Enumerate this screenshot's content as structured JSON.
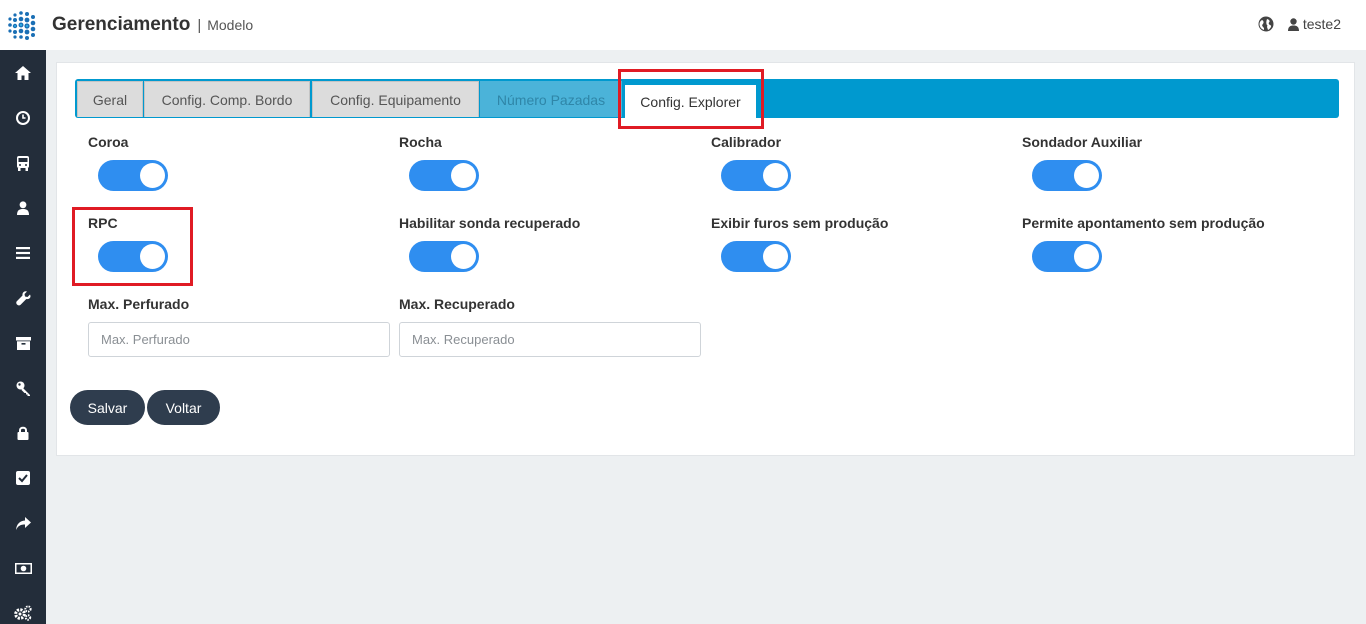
{
  "header": {
    "title": "Gerenciamento",
    "separator": "|",
    "subtitle": "Modelo",
    "globe_icon": "globe-icon",
    "user_icon": "user-icon",
    "username": "teste2"
  },
  "sidebar": {
    "items": [
      {
        "icon": "home-icon"
      },
      {
        "icon": "clock-icon"
      },
      {
        "icon": "bus-icon"
      },
      {
        "icon": "user-icon"
      },
      {
        "icon": "menu-icon"
      },
      {
        "icon": "wrench-icon"
      },
      {
        "icon": "archive-icon"
      },
      {
        "icon": "key-icon"
      },
      {
        "icon": "lock-icon"
      },
      {
        "icon": "checkbox-icon"
      },
      {
        "icon": "share-icon"
      },
      {
        "icon": "money-icon"
      },
      {
        "icon": "gears-icon"
      }
    ]
  },
  "tabs": [
    {
      "label": "Geral"
    },
    {
      "label": "Config. Comp. Bordo"
    },
    {
      "label": "Config. Equipamento"
    },
    {
      "label": "Número Pazadas"
    },
    {
      "label": "Config. Explorer"
    }
  ],
  "active_tab": "Config. Explorer",
  "toggles": [
    {
      "label": "Coroa",
      "on": true
    },
    {
      "label": "Rocha",
      "on": true
    },
    {
      "label": "Calibrador",
      "on": true
    },
    {
      "label": "Sondador Auxiliar",
      "on": true
    },
    {
      "label": "RPC",
      "on": true
    },
    {
      "label": "Habilitar sonda recuperado",
      "on": true
    },
    {
      "label": "Exibir furos sem produção",
      "on": true
    },
    {
      "label": "Permite apontamento sem produção",
      "on": true
    }
  ],
  "inputs": {
    "max_perfurado": {
      "label": "Max. Perfurado",
      "placeholder": "Max. Perfurado",
      "value": ""
    },
    "max_recuperado": {
      "label": "Max. Recuperado",
      "placeholder": "Max. Recuperado",
      "value": ""
    }
  },
  "buttons": {
    "save": "Salvar",
    "back": "Voltar"
  },
  "colors": {
    "sidebar": "#232d3a",
    "tabbar": "#0099cf",
    "toggle_on": "#2f8ef0",
    "button": "#2f3d4e",
    "highlight": "#e01b24"
  }
}
